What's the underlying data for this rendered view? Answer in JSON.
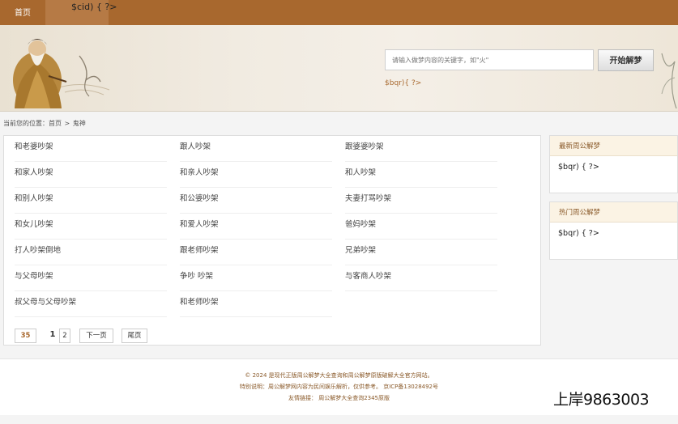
{
  "nav": {
    "home_label": "首页",
    "php_tab_label": "$cid) { ?>"
  },
  "banner": {
    "search_placeholder": "请输入做梦内容的关键字，如\"火\"",
    "search_button_label": "开始解梦",
    "php_text": "$bqr){ ?>"
  },
  "breadcrumb": {
    "prefix": "当前您的位置：",
    "home": "首页",
    "separator": ">",
    "current": "鬼神"
  },
  "links": [
    [
      "和老婆吵架",
      "跟人吵架",
      "跟婆婆吵架"
    ],
    [
      "和家人吵架",
      "和亲人吵架",
      "和人吵架"
    ],
    [
      "和别人吵架",
      "和公婆吵架",
      "夫妻打骂吵架"
    ],
    [
      "和女儿吵架",
      "和爱人吵架",
      "爸妈吵架"
    ],
    [
      "打人吵架倒地",
      "跟老师吵架",
      "兄弟吵架"
    ],
    [
      "与父母吵架",
      "争吵  吵架",
      "与客商人吵架"
    ],
    [
      "叔父母与父母吵架",
      "和老师吵架",
      ""
    ]
  ],
  "pagination": {
    "total": "35",
    "current": "1",
    "page2": "2",
    "next": "下一页",
    "last": "尾页"
  },
  "sidebar": {
    "latest": {
      "title": "最新周公解梦",
      "php_text": "$bqr) { ?>"
    },
    "hot": {
      "title": "热门周公解梦",
      "php_text": "$bqr) { ?>"
    }
  },
  "footer": {
    "line1": "© 2024 是现代正版周公解梦大全查询和周公解梦原版破解大全官方网站。",
    "line2": "特别说明：周公解梦网内容为民间娱乐解析，仅供参考。 京ICP备13028492号",
    "line3": "友情链接： 周公解梦大全查询2345原版"
  },
  "watermark": "上岸9863003",
  "colors": {
    "nav_brown": "#a8682e",
    "accent": "#8a5a2a"
  }
}
